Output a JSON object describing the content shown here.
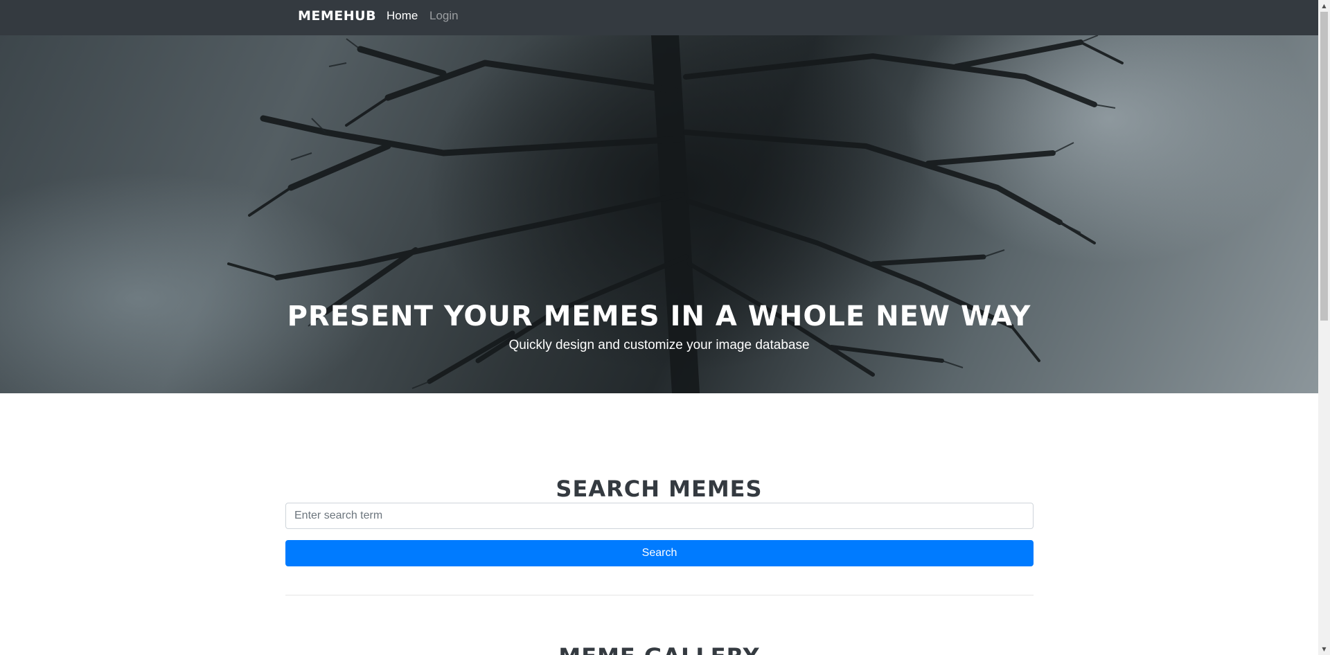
{
  "navbar": {
    "brand": "MEMEHUB",
    "links": [
      {
        "label": "Home",
        "active": true
      },
      {
        "label": "Login",
        "active": false
      }
    ]
  },
  "hero": {
    "title": "Present your memes in a whole new way",
    "subtitle": "Quickly design and customize your image database"
  },
  "search": {
    "heading": "Search Memes",
    "placeholder": "Enter search term",
    "value": "",
    "button_label": "Search"
  },
  "gallery": {
    "heading": "Meme Gallery"
  },
  "colors": {
    "navbar_bg": "#343a40",
    "primary": "#007bff",
    "heading": "#343a40"
  },
  "icons": {
    "scroll_up": "scroll-up-arrow-icon",
    "scroll_down": "scroll-down-arrow-icon"
  }
}
